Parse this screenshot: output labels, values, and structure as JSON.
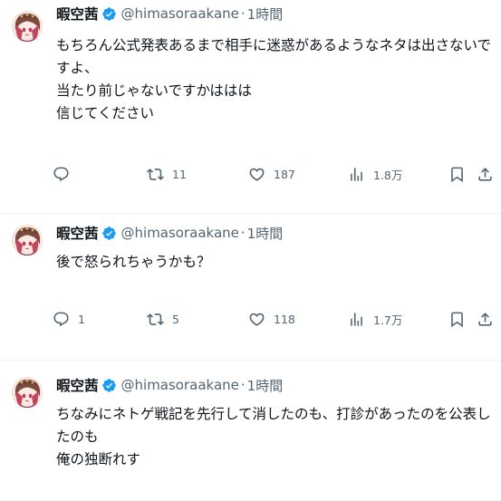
{
  "posts": [
    {
      "author_name": "暇空茜",
      "author_handle": "@himasoraakane",
      "separator": "·",
      "time": "1時間",
      "text": "もちろん公式発表あるまで相手に迷惑があるようなネタは出さないですよ、\n当たり前じゃないですかははは\n信じてください",
      "reply_count": "",
      "retweet_count": "11",
      "like_count": "187",
      "view_count": "1.8万"
    },
    {
      "author_name": "暇空茜",
      "author_handle": "@himasoraakane",
      "separator": "·",
      "time": "1時間",
      "text": "後で怒られちゃうかも？",
      "reply_count": "1",
      "retweet_count": "5",
      "like_count": "118",
      "view_count": "1.7万"
    },
    {
      "author_name": "暇空茜",
      "author_handle": "@himasoraakane",
      "separator": "·",
      "time": "1時間",
      "text": "ちなみにネトゲ戦記を先行して消したのも、打診があったのを公表したのも\n俺の独断れす"
    }
  ],
  "colors": {
    "text_primary": "#0f1419",
    "text_secondary": "#536471",
    "verified_blue": "#1d9bf0",
    "divider": "#eff3f4"
  },
  "icons": [
    "reply-icon",
    "retweet-icon",
    "like-icon",
    "views-icon",
    "bookmark-icon",
    "share-icon",
    "verified-icon"
  ]
}
